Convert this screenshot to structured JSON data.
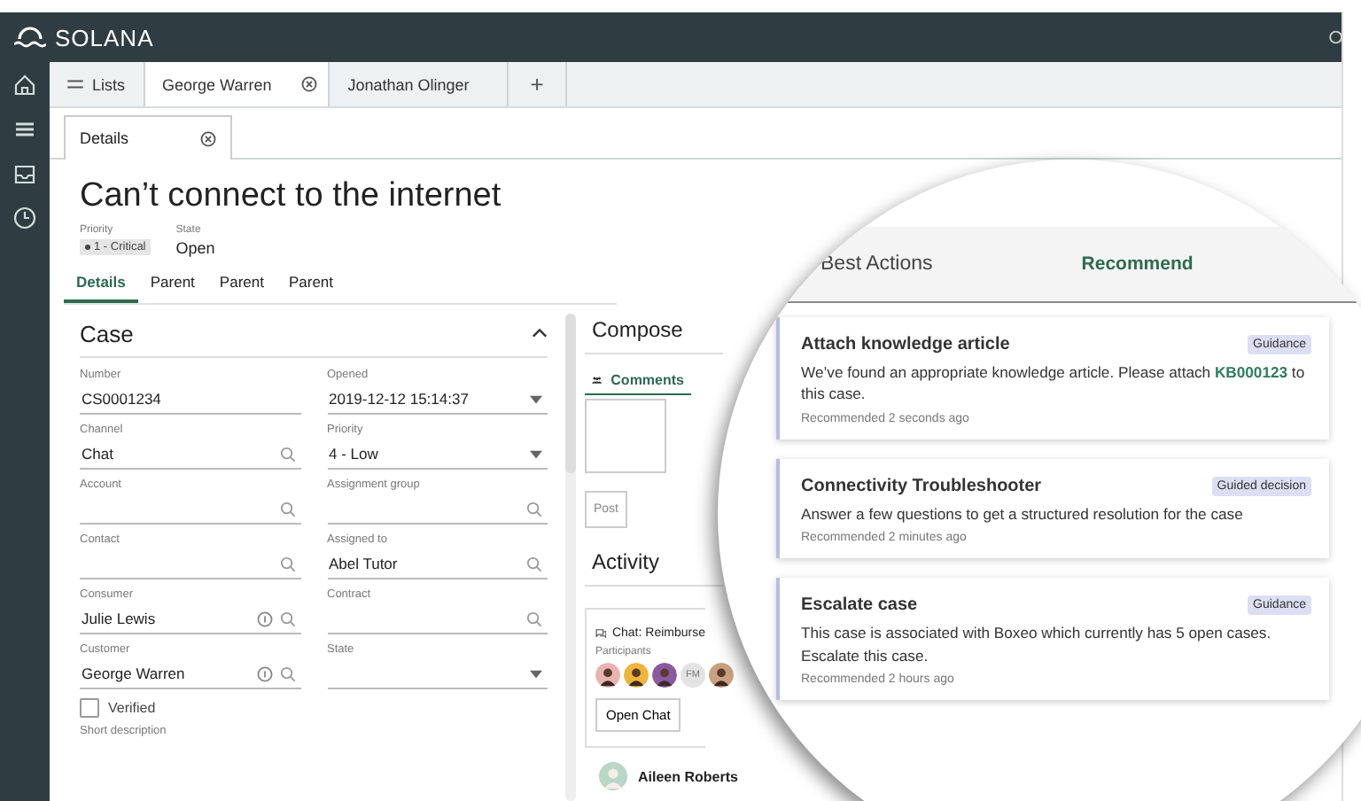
{
  "app": {
    "name": "SOLANA"
  },
  "tabs": [
    {
      "label": "Lists",
      "kind": "lists",
      "selected": false
    },
    {
      "label": "George Warren",
      "kind": "record",
      "selected": true
    },
    {
      "label": "Jonathan Olinger",
      "kind": "plain",
      "selected": false
    },
    {
      "label": "+",
      "kind": "add",
      "selected": false
    }
  ],
  "subtab": {
    "label": "Details"
  },
  "record": {
    "title": "Can’t connect to the internet",
    "priority_label": "Priority",
    "priority": "1 - Critical",
    "state_label": "State",
    "state": "Open"
  },
  "section_tabs": [
    {
      "label": "Details",
      "selected": true
    },
    {
      "label": "Parent",
      "selected": false
    },
    {
      "label": "Parent",
      "selected": false
    },
    {
      "label": "Parent",
      "selected": false
    }
  ],
  "case": {
    "title": "Case",
    "fields": [
      {
        "label": "Number",
        "value": "CS0001234",
        "kind": "text"
      },
      {
        "label": "Opened",
        "value": "2019-12-12 15:14:37",
        "kind": "dropdown"
      },
      {
        "label": "Channel",
        "value": "Chat",
        "kind": "search"
      },
      {
        "label": "Priority",
        "value": "4 - Low",
        "kind": "dropdown"
      },
      {
        "label": "Account",
        "kind": "search"
      },
      {
        "label": "Assignment group",
        "kind": "search"
      },
      {
        "label": "Contact",
        "kind": "search"
      },
      {
        "label": "Assigned to",
        "value": "Abel Tutor",
        "kind": "search"
      },
      {
        "label": "Consumer",
        "value": "Julie Lewis",
        "kind": "info-search"
      },
      {
        "label": "Contract",
        "kind": "search"
      },
      {
        "label": "Customer",
        "value": "George Warren",
        "kind": "info-search"
      },
      {
        "label": "State",
        "kind": "dropdown"
      }
    ],
    "verified": {
      "label": "Verified",
      "checked": false
    },
    "next_label": "Short description"
  },
  "compose": {
    "title": "Compose",
    "tab": "Comments",
    "button": "Post"
  },
  "activity": {
    "title": "Activity",
    "chat_title": "Chat: Reimburse",
    "participants_label": "Participants",
    "participants": [
      {
        "kind": "photo"
      },
      {
        "kind": "photo"
      },
      {
        "kind": "photo"
      },
      {
        "kind": "initials",
        "initials": "FM"
      },
      {
        "kind": "photo"
      }
    ],
    "open_button": "Open Chat",
    "author": "Aileen Roberts"
  },
  "best_actions": {
    "title": "Best Actions",
    "link": "Recommend",
    "cards": [
      {
        "title": "Attach knowledge article",
        "tag": "Guidance",
        "body": "We’ve found an appropriate knowledge article. Please attach",
        "link": "KB000123",
        "body_after": " to this case.",
        "time": "Recommended 2 seconds ago"
      },
      {
        "title": "Connectivity Troubleshooter",
        "tag": "Guided decision",
        "body": "Answer a few questions to get a structured resolution for the case",
        "time": "Recommended 2 minutes ago"
      },
      {
        "title": "Escalate case",
        "tag": "Guidance",
        "body": "This case is associated with Boxeo which currently has 5 open cases. Escalate this case.",
        "time": "Recommended 2 hours ago"
      }
    ]
  }
}
